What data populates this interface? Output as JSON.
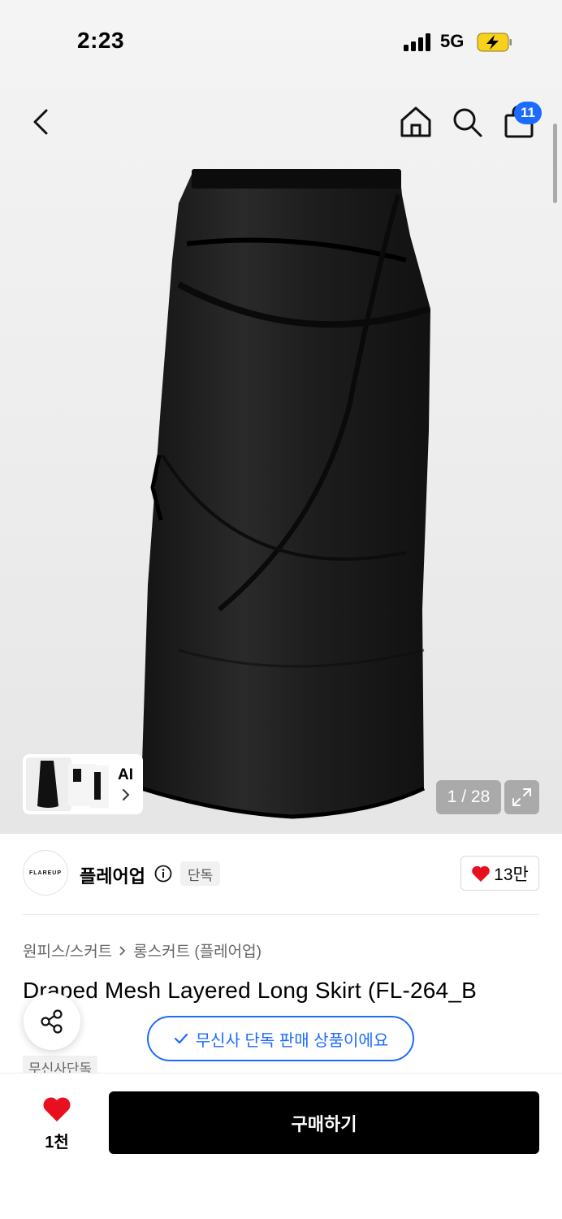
{
  "status_bar": {
    "time": "2:23",
    "network": "5G"
  },
  "header": {
    "cart_count": "11"
  },
  "image_gallery": {
    "counter": "1 / 28",
    "ai_label": "AI"
  },
  "brand": {
    "logo_text": "FLAREUP",
    "name": "플레어업",
    "exclusive_badge": "단독",
    "likes": "13만"
  },
  "breadcrumb": {
    "category": "원피스/스커트",
    "subcategory": "롱스커트 (플레어업)"
  },
  "product": {
    "title": "Draped Mesh Layered Long Skirt (FL-264_B",
    "tag": "무신사단독"
  },
  "exclusive_notice": "무신사 단독 판매 상품이에요",
  "bottom_bar": {
    "wish_count": "1천",
    "buy_label": "구매하기"
  },
  "colors": {
    "accent_blue": "#1c6bff",
    "heart_red": "#e8101f",
    "charge_yellow": "#f7d11b"
  },
  "icons": [
    "back-icon",
    "home-icon",
    "search-icon",
    "cart-icon",
    "info-icon",
    "heart-icon",
    "share-icon",
    "check-icon",
    "expand-icon",
    "chevron-right-icon"
  ]
}
